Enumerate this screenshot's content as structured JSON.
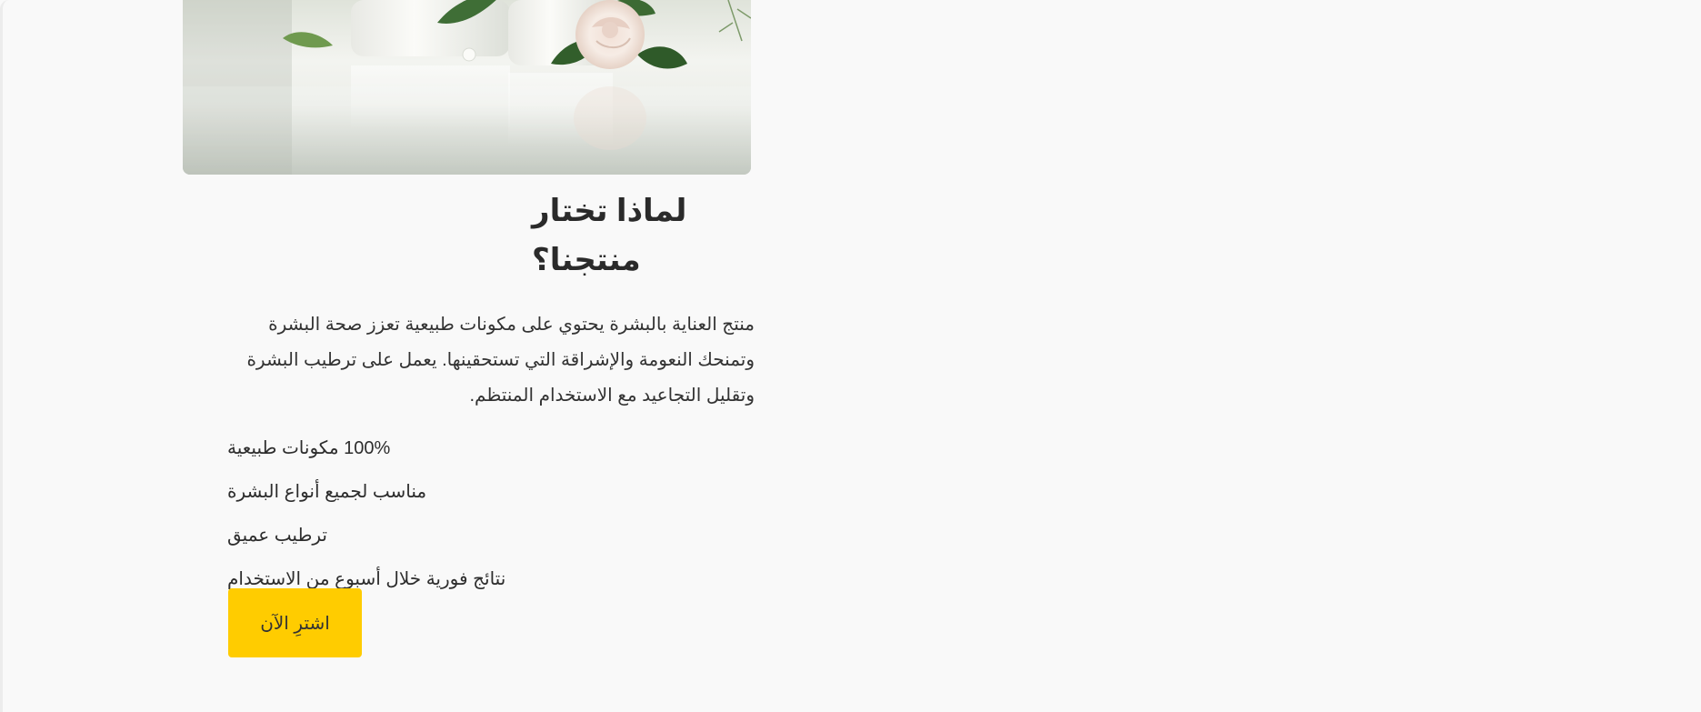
{
  "hero": {
    "image_subject": "skincare cream jars with white rose and green leaves"
  },
  "why_section": {
    "title": "لماذا تختار منتجنا؟",
    "description": "منتج العناية بالبشرة يحتوي على مكونات طبيعية تعزز صحة البشرة وتمنحك النعومة والإشراقة التي تستحقينها. يعمل على ترطيب البشرة وتقليل التجاعيد مع الاستخدام المنتظم.",
    "features": [
      "100% مكونات طبيعية",
      "مناسب لجميع أنواع البشرة",
      "ترطيب عميق",
      "نتائج فورية خلال أسبوع من الاستخدام"
    ],
    "buy_label": "اشترِ الآن"
  },
  "colors": {
    "background": "#f9f9f9",
    "button": "#ffcc00",
    "text": "#2b2b2b"
  }
}
